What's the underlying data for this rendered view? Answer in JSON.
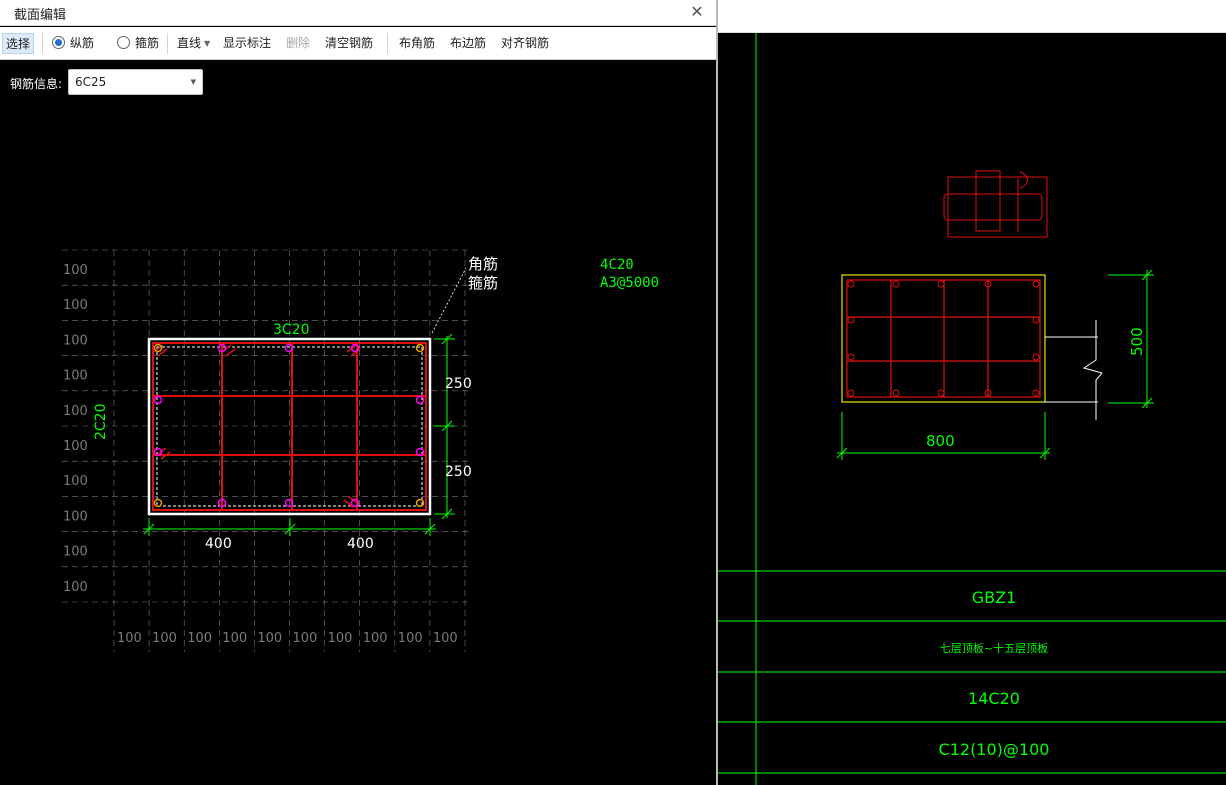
{
  "dialog": {
    "title": "截面编辑",
    "close_glyph": "✕"
  },
  "toolbar": {
    "select": "选择",
    "longitudinal": "纵筋",
    "stirrup": "箍筋",
    "line": "直线",
    "show_dims": "显示标注",
    "delete": "删除",
    "clear": "清空钢筋",
    "corner": "布角筋",
    "edge": "布边筋",
    "align": "对齐钢筋"
  },
  "rebar_info": {
    "label": "钢筋信息:",
    "value": "6C25"
  },
  "section": {
    "grid_label": "100",
    "callout_line1": "角筋",
    "callout_line2": "箍筋",
    "top_label": "3C20",
    "left_label": "2C20",
    "info_line1": "4C20",
    "info_line2": "A3@5000",
    "dim_v1": "250",
    "dim_v2": "250",
    "dim_h1": "400",
    "dim_h2": "400"
  },
  "cad": {
    "dim_width": "800",
    "dim_height": "500",
    "table": [
      "GBZ1",
      "七层顶板~十五层顶板",
      "14C20",
      "C12(10)@100"
    ]
  },
  "colors": {
    "green": "#00ff00",
    "red": "#e01010",
    "white": "#ffffff",
    "magenta": "#ff00ff",
    "grid": "#7a7a7a",
    "yellow": "#e6e600",
    "accent": "#1f6fd1"
  }
}
